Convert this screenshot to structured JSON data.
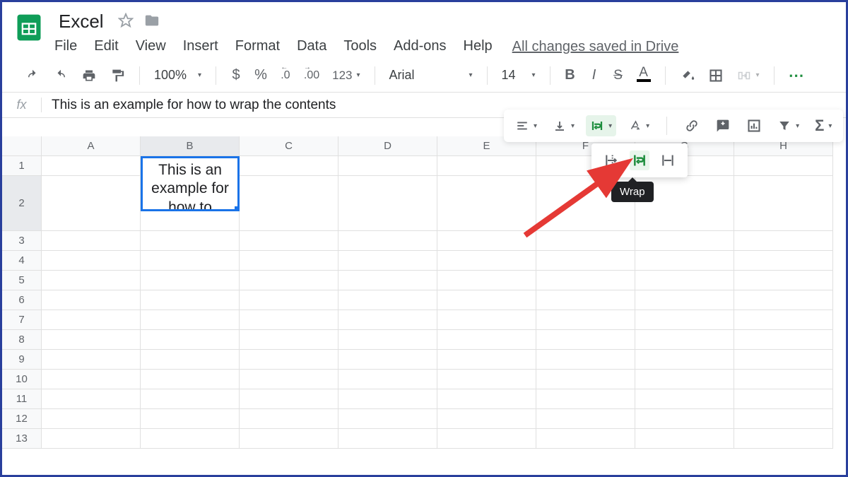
{
  "header": {
    "title": "Excel",
    "menu": [
      "File",
      "Edit",
      "View",
      "Insert",
      "Format",
      "Data",
      "Tools",
      "Add-ons",
      "Help"
    ],
    "saved_status": "All changes saved in Drive"
  },
  "toolbar": {
    "zoom": "100%",
    "currency": "$",
    "percent": "%",
    "dec_dec": ".0",
    "dec_inc": ".00",
    "numfmt": "123",
    "font": "Arial",
    "font_size": "14",
    "bold": "B",
    "italic": "I",
    "strike": "S",
    "textcolor": "A",
    "more": "⋯"
  },
  "toolbar2": {
    "wrap_tooltip": "Wrap"
  },
  "formula_bar": {
    "label": "fx",
    "value": "This is an example for how to wrap the contents"
  },
  "grid": {
    "columns": [
      "A",
      "B",
      "C",
      "D",
      "E",
      "F",
      "G",
      "H"
    ],
    "rows": [
      "1",
      "2",
      "3",
      "4",
      "5",
      "6",
      "7",
      "8",
      "9",
      "10",
      "11",
      "12",
      "13"
    ],
    "selected_cell": "B2",
    "selected_col_index": 1,
    "selected_row_index": 1,
    "cell_content": "This is an example for how to"
  }
}
